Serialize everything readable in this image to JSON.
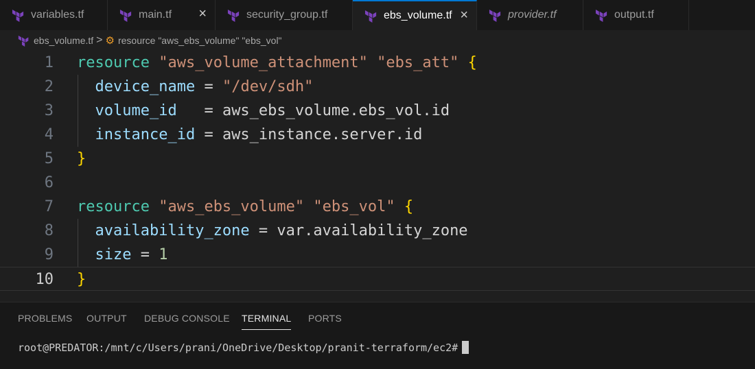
{
  "tabs": [
    {
      "label": "variables.tf",
      "icon": "terraform-icon",
      "active": false,
      "italic": false,
      "close": false
    },
    {
      "label": "main.tf",
      "icon": "terraform-icon",
      "active": false,
      "italic": false,
      "close": true
    },
    {
      "label": "security_group.tf",
      "icon": "terraform-icon",
      "active": false,
      "italic": false,
      "close": false
    },
    {
      "label": "ebs_volume.tf",
      "icon": "terraform-icon",
      "active": true,
      "italic": false,
      "close": true
    },
    {
      "label": "provider.tf",
      "icon": "terraform-icon",
      "active": false,
      "italic": true,
      "close": false
    },
    {
      "label": "output.tf",
      "icon": "terraform-icon",
      "active": false,
      "italic": false,
      "close": false
    }
  ],
  "close_glyph": "×",
  "breadcrumb": {
    "file": "ebs_volume.tf",
    "separator": ">",
    "symbol_icon": "symbol-class-icon",
    "symbol": "resource \"aws_ebs_volume\" \"ebs_vol\""
  },
  "editor": {
    "current_line": 10,
    "lines": [
      {
        "n": "1",
        "tokens": [
          [
            "kw",
            "resource"
          ],
          [
            "plain",
            " "
          ],
          [
            "str",
            "\"aws_volume_attachment\""
          ],
          [
            "plain",
            " "
          ],
          [
            "str",
            "\"ebs_att\""
          ],
          [
            "plain",
            " "
          ],
          [
            "brace",
            "{"
          ]
        ]
      },
      {
        "n": "2",
        "tokens": [
          [
            "plain",
            "  "
          ],
          [
            "attr",
            "device_name"
          ],
          [
            "plain",
            " = "
          ],
          [
            "str",
            "\"/dev/sdh\""
          ]
        ]
      },
      {
        "n": "3",
        "tokens": [
          [
            "plain",
            "  "
          ],
          [
            "attr",
            "volume_id"
          ],
          [
            "plain",
            "   = aws_ebs_volume.ebs_vol.id"
          ]
        ]
      },
      {
        "n": "4",
        "tokens": [
          [
            "plain",
            "  "
          ],
          [
            "attr",
            "instance_id"
          ],
          [
            "plain",
            " = aws_instance.server.id"
          ]
        ]
      },
      {
        "n": "5",
        "tokens": [
          [
            "brace",
            "}"
          ]
        ]
      },
      {
        "n": "6",
        "tokens": []
      },
      {
        "n": "7",
        "tokens": [
          [
            "kw",
            "resource"
          ],
          [
            "plain",
            " "
          ],
          [
            "str",
            "\"aws_ebs_volume\""
          ],
          [
            "plain",
            " "
          ],
          [
            "str",
            "\"ebs_vol\""
          ],
          [
            "plain",
            " "
          ],
          [
            "brace",
            "{"
          ]
        ]
      },
      {
        "n": "8",
        "tokens": [
          [
            "plain",
            "  "
          ],
          [
            "attr",
            "availability_zone"
          ],
          [
            "plain",
            " = var.availability_zone"
          ]
        ]
      },
      {
        "n": "9",
        "tokens": [
          [
            "plain",
            "  "
          ],
          [
            "attr",
            "size"
          ],
          [
            "plain",
            " = "
          ],
          [
            "num",
            "1"
          ]
        ]
      },
      {
        "n": "10",
        "tokens": [
          [
            "brace",
            "}"
          ]
        ]
      }
    ]
  },
  "panel": {
    "tabs": [
      "PROBLEMS",
      "OUTPUT",
      "DEBUG CONSOLE",
      "TERMINAL",
      "PORTS"
    ],
    "active": "TERMINAL",
    "prompt": "root@PREDATOR:/mnt/c/Users/prani/OneDrive/Desktop/pranit-terraform/ec2#"
  },
  "colors": {
    "terraform_purple": "#7b42bc",
    "accent": "#0078d4",
    "keyword": "#4ec9b0",
    "string": "#ce9178",
    "attribute": "#9cdcfe",
    "number": "#b5cea8",
    "brace": "#ffd700"
  }
}
